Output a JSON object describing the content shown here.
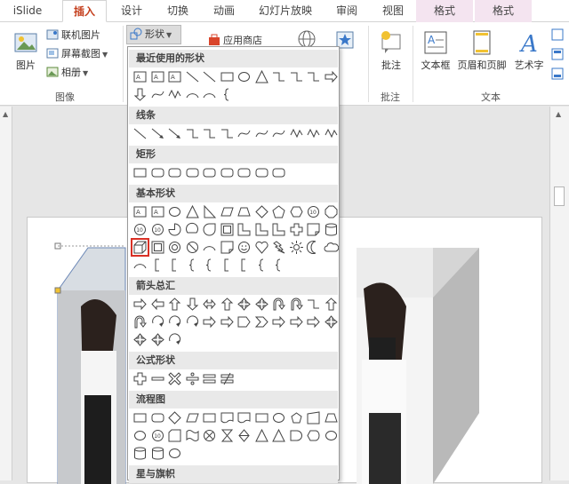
{
  "tabs": [
    {
      "label": "iSlide"
    },
    {
      "label": "插入"
    },
    {
      "label": "设计"
    },
    {
      "label": "切换"
    },
    {
      "label": "动画"
    },
    {
      "label": "幻灯片放映"
    },
    {
      "label": "审阅"
    },
    {
      "label": "视图"
    },
    {
      "label": "格式"
    },
    {
      "label": "格式"
    }
  ],
  "ribbon": {
    "image_group": {
      "picture": "图片",
      "online_picture": "联机图片",
      "screenshot": "屏幕截图",
      "album": "相册",
      "label": "图像"
    },
    "shapes_button": "形状",
    "app_store": "应用商店",
    "comment": "批注",
    "comment_group_label": "批注",
    "text_group": {
      "textbox": "文本框",
      "header_footer": "页眉和页脚",
      "wordart": "艺术字",
      "label": "文本"
    }
  },
  "dropdown": {
    "categories": {
      "recent": "最近使用的形状",
      "lines": "线条",
      "rectangles": "矩形",
      "basic": "基本形状",
      "arrows": "箭头总汇",
      "equation": "公式形状",
      "flowchart": "流程图",
      "stars": "星与旗帜"
    },
    "selected_shape": "cube"
  },
  "colors": {
    "active_tab": "#c43e1c",
    "selection_outline": "#d93025",
    "context_tab_bg": "#f4e4f0",
    "category_bg": "#e9e9e9"
  }
}
